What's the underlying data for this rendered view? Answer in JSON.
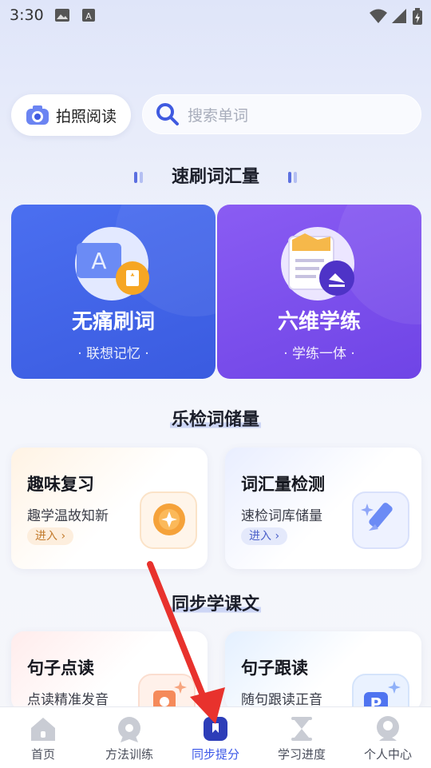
{
  "status_bar": {
    "time": "3:30"
  },
  "top_row": {
    "photo_read_label": "拍照阅读",
    "search_placeholder": "搜索单词"
  },
  "sections": {
    "speed_vocab_title": "速刷词汇量",
    "vocab_check_title": "乐检词储量",
    "sync_text_title": "同步学课文"
  },
  "big_cards": [
    {
      "title": "无痛刷词",
      "subtitle": "· 联想记忆 ·"
    },
    {
      "title": "六维学练",
      "subtitle": "· 学练一体 ·"
    }
  ],
  "small_cards": [
    {
      "title": "趣味复习",
      "desc": "趣学温故知新",
      "action": "进入 ›"
    },
    {
      "title": "词汇量检测",
      "desc": "速检词库储量",
      "action": "进入 ›"
    },
    {
      "title": "句子点读",
      "desc": "点读精准发音"
    },
    {
      "title": "句子跟读",
      "desc": "随句跟读正音"
    }
  ],
  "bottom_nav": [
    {
      "label": "首页",
      "icon": "home-icon"
    },
    {
      "label": "方法训练",
      "icon": "badge-icon"
    },
    {
      "label": "同步提分",
      "icon": "bookmark-icon",
      "active": true
    },
    {
      "label": "学习进度",
      "icon": "hourglass-icon"
    },
    {
      "label": "个人中心",
      "icon": "profile-icon"
    }
  ],
  "colors": {
    "accent": "#3b57e8",
    "card_blue": "#4263eb",
    "card_purple": "#7a4ded",
    "annotation_arrow": "#e8322d"
  }
}
